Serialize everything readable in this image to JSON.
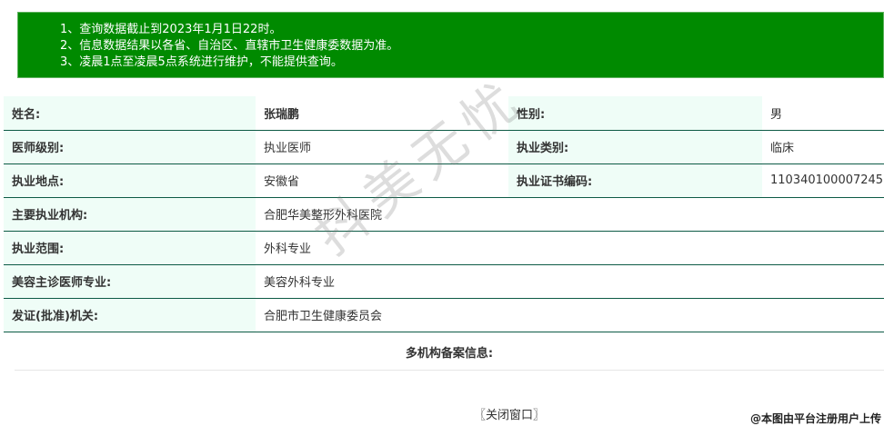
{
  "notice": {
    "lines": [
      "1、查询数据截止到2023年1月1日22时。",
      "2、信息数据结果以各省、自治区、直辖市卫生健康委数据为准。",
      "3、凌晨1点至凌晨5点系统进行维护，不能提供查询。"
    ]
  },
  "info": {
    "name_label": "姓名:",
    "name_value": "张瑞鹏",
    "gender_label": "性别:",
    "gender_value": "男",
    "level_label": "医师级别:",
    "level_value": "执业医师",
    "category_label": "执业类别:",
    "category_value": "临床",
    "location_label": "执业地点:",
    "location_value": "安徽省",
    "cert_label": "执业证书编码:",
    "cert_value": "110340100007245",
    "institution_label": "主要执业机构:",
    "institution_value": "合肥华美整形外科医院",
    "scope_label": "执业范围:",
    "scope_value": "外科专业",
    "specialty_label": "美容主诊医师专业:",
    "specialty_value": "美容外科专业",
    "authority_label": "发证(批准)机关:",
    "authority_value": "合肥市卫生健康委员会"
  },
  "multi_label": "多机构备案信息:",
  "close_label": "〖关闭窗口〗",
  "watermark": "抖美无忧",
  "credit": "@本图由平台注册用户上传"
}
